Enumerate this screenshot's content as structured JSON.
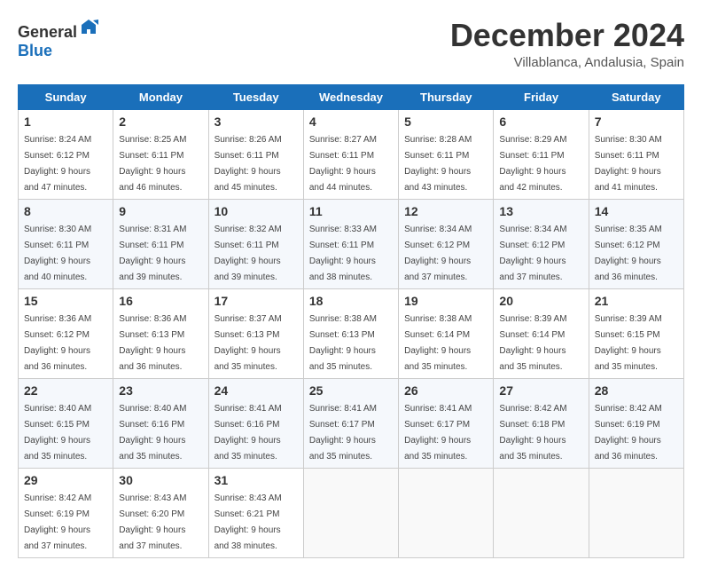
{
  "header": {
    "logo_general": "General",
    "logo_blue": "Blue",
    "month_title": "December 2024",
    "location": "Villablanca, Andalusia, Spain"
  },
  "calendar": {
    "headers": [
      "Sunday",
      "Monday",
      "Tuesday",
      "Wednesday",
      "Thursday",
      "Friday",
      "Saturday"
    ],
    "weeks": [
      [
        null,
        {
          "day": "2",
          "sunrise": "Sunrise: 8:25 AM",
          "sunset": "Sunset: 6:11 PM",
          "daylight": "Daylight: 9 hours and 46 minutes."
        },
        {
          "day": "3",
          "sunrise": "Sunrise: 8:26 AM",
          "sunset": "Sunset: 6:11 PM",
          "daylight": "Daylight: 9 hours and 45 minutes."
        },
        {
          "day": "4",
          "sunrise": "Sunrise: 8:27 AM",
          "sunset": "Sunset: 6:11 PM",
          "daylight": "Daylight: 9 hours and 44 minutes."
        },
        {
          "day": "5",
          "sunrise": "Sunrise: 8:28 AM",
          "sunset": "Sunset: 6:11 PM",
          "daylight": "Daylight: 9 hours and 43 minutes."
        },
        {
          "day": "6",
          "sunrise": "Sunrise: 8:29 AM",
          "sunset": "Sunset: 6:11 PM",
          "daylight": "Daylight: 9 hours and 42 minutes."
        },
        {
          "day": "7",
          "sunrise": "Sunrise: 8:30 AM",
          "sunset": "Sunset: 6:11 PM",
          "daylight": "Daylight: 9 hours and 41 minutes."
        }
      ],
      [
        {
          "day": "1",
          "sunrise": "Sunrise: 8:24 AM",
          "sunset": "Sunset: 6:12 PM",
          "daylight": "Daylight: 9 hours and 47 minutes."
        },
        {
          "day": "9",
          "sunrise": "Sunrise: 8:31 AM",
          "sunset": "Sunset: 6:11 PM",
          "daylight": "Daylight: 9 hours and 39 minutes."
        },
        {
          "day": "10",
          "sunrise": "Sunrise: 8:32 AM",
          "sunset": "Sunset: 6:11 PM",
          "daylight": "Daylight: 9 hours and 39 minutes."
        },
        {
          "day": "11",
          "sunrise": "Sunrise: 8:33 AM",
          "sunset": "Sunset: 6:11 PM",
          "daylight": "Daylight: 9 hours and 38 minutes."
        },
        {
          "day": "12",
          "sunrise": "Sunrise: 8:34 AM",
          "sunset": "Sunset: 6:12 PM",
          "daylight": "Daylight: 9 hours and 37 minutes."
        },
        {
          "day": "13",
          "sunrise": "Sunrise: 8:34 AM",
          "sunset": "Sunset: 6:12 PM",
          "daylight": "Daylight: 9 hours and 37 minutes."
        },
        {
          "day": "14",
          "sunrise": "Sunrise: 8:35 AM",
          "sunset": "Sunset: 6:12 PM",
          "daylight": "Daylight: 9 hours and 36 minutes."
        }
      ],
      [
        {
          "day": "8",
          "sunrise": "Sunrise: 8:30 AM",
          "sunset": "Sunset: 6:11 PM",
          "daylight": "Daylight: 9 hours and 40 minutes."
        },
        {
          "day": "16",
          "sunrise": "Sunrise: 8:36 AM",
          "sunset": "Sunset: 6:13 PM",
          "daylight": "Daylight: 9 hours and 36 minutes."
        },
        {
          "day": "17",
          "sunrise": "Sunrise: 8:37 AM",
          "sunset": "Sunset: 6:13 PM",
          "daylight": "Daylight: 9 hours and 35 minutes."
        },
        {
          "day": "18",
          "sunrise": "Sunrise: 8:38 AM",
          "sunset": "Sunset: 6:13 PM",
          "daylight": "Daylight: 9 hours and 35 minutes."
        },
        {
          "day": "19",
          "sunrise": "Sunrise: 8:38 AM",
          "sunset": "Sunset: 6:14 PM",
          "daylight": "Daylight: 9 hours and 35 minutes."
        },
        {
          "day": "20",
          "sunrise": "Sunrise: 8:39 AM",
          "sunset": "Sunset: 6:14 PM",
          "daylight": "Daylight: 9 hours and 35 minutes."
        },
        {
          "day": "21",
          "sunrise": "Sunrise: 8:39 AM",
          "sunset": "Sunset: 6:15 PM",
          "daylight": "Daylight: 9 hours and 35 minutes."
        }
      ],
      [
        {
          "day": "15",
          "sunrise": "Sunrise: 8:36 AM",
          "sunset": "Sunset: 6:12 PM",
          "daylight": "Daylight: 9 hours and 36 minutes."
        },
        {
          "day": "23",
          "sunrise": "Sunrise: 8:40 AM",
          "sunset": "Sunset: 6:16 PM",
          "daylight": "Daylight: 9 hours and 35 minutes."
        },
        {
          "day": "24",
          "sunrise": "Sunrise: 8:41 AM",
          "sunset": "Sunset: 6:16 PM",
          "daylight": "Daylight: 9 hours and 35 minutes."
        },
        {
          "day": "25",
          "sunrise": "Sunrise: 8:41 AM",
          "sunset": "Sunset: 6:17 PM",
          "daylight": "Daylight: 9 hours and 35 minutes."
        },
        {
          "day": "26",
          "sunrise": "Sunrise: 8:41 AM",
          "sunset": "Sunset: 6:17 PM",
          "daylight": "Daylight: 9 hours and 35 minutes."
        },
        {
          "day": "27",
          "sunrise": "Sunrise: 8:42 AM",
          "sunset": "Sunset: 6:18 PM",
          "daylight": "Daylight: 9 hours and 35 minutes."
        },
        {
          "day": "28",
          "sunrise": "Sunrise: 8:42 AM",
          "sunset": "Sunset: 6:19 PM",
          "daylight": "Daylight: 9 hours and 36 minutes."
        }
      ],
      [
        {
          "day": "22",
          "sunrise": "Sunrise: 8:40 AM",
          "sunset": "Sunset: 6:15 PM",
          "daylight": "Daylight: 9 hours and 35 minutes."
        },
        {
          "day": "30",
          "sunrise": "Sunrise: 8:43 AM",
          "sunset": "Sunset: 6:20 PM",
          "daylight": "Daylight: 9 hours and 37 minutes."
        },
        {
          "day": "31",
          "sunrise": "Sunrise: 8:43 AM",
          "sunset": "Sunset: 6:21 PM",
          "daylight": "Daylight: 9 hours and 38 minutes."
        },
        null,
        null,
        null,
        null
      ],
      [
        {
          "day": "29",
          "sunrise": "Sunrise: 8:42 AM",
          "sunset": "Sunset: 6:19 PM",
          "daylight": "Daylight: 9 hours and 37 minutes."
        },
        null,
        null,
        null,
        null,
        null,
        null
      ]
    ]
  }
}
